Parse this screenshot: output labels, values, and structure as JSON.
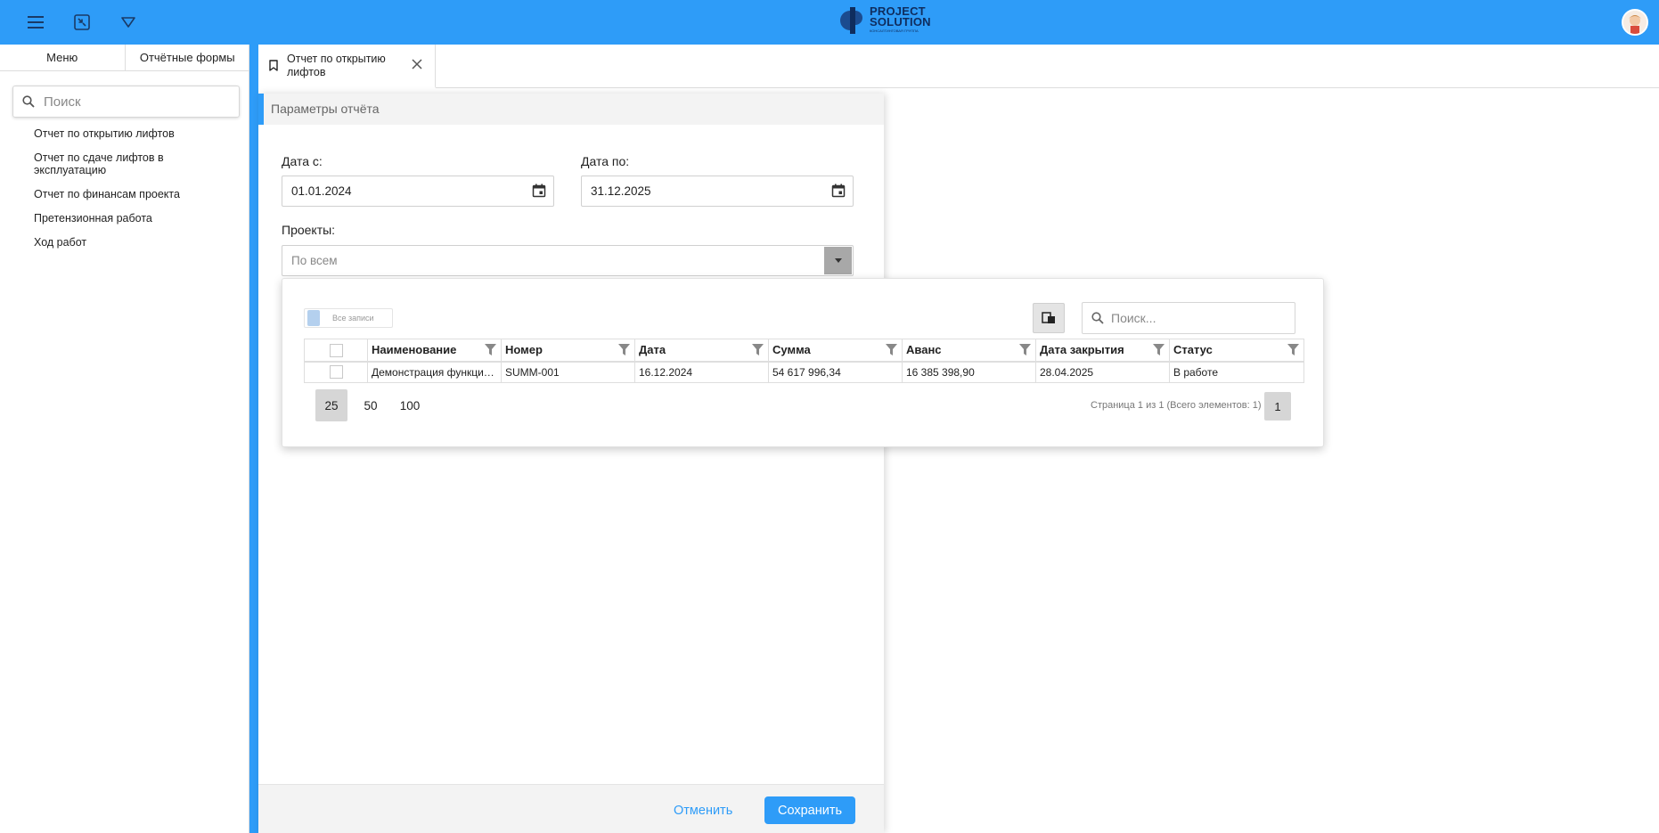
{
  "brand": {
    "line1": "PROJECT",
    "line2": "SOLUTION",
    "tagline": "КОНСАЛТИНГОВАЯ ГРУППА"
  },
  "sidebar": {
    "tabs": [
      {
        "label": "Меню"
      },
      {
        "label": "Отчётные формы"
      }
    ],
    "search_placeholder": "Поиск",
    "items": [
      {
        "label": "Отчет по открытию лифтов"
      },
      {
        "label": "Отчет по сдаче лифтов в эксплуатацию"
      },
      {
        "label": "Отчет по финансам проекта"
      },
      {
        "label": "Претензионная работа"
      },
      {
        "label": "Ход работ"
      }
    ]
  },
  "doc_tab": {
    "label": "Отчет по открытию лифтов"
  },
  "params": {
    "title": "Параметры отчёта",
    "date_from_label": "Дата с:",
    "date_from_value": "01.01.2024",
    "date_to_label": "Дата по:",
    "date_to_value": "31.12.2025",
    "projects_label": "Проекты:",
    "projects_placeholder": "По всем",
    "cancel_label": "Отменить",
    "save_label": "Сохранить"
  },
  "popup": {
    "all_records_label": "Все записи",
    "search_placeholder": "Поиск...",
    "columns": [
      "Наименование",
      "Номер",
      "Дата",
      "Сумма",
      "Аванс",
      "Дата закрытия",
      "Статус"
    ],
    "rows": [
      [
        "Демонстрация функциональных возможностей",
        "SUMM-001",
        "16.12.2024",
        "54 617 996,34",
        "16 385 398,90",
        "28.04.2025",
        "В работе"
      ]
    ],
    "page_sizes": [
      "25",
      "50",
      "100"
    ],
    "page_info": "Страница 1 из 1 (Всего элементов: 1)",
    "current_page": "1"
  },
  "colors": {
    "accent": "#2e9cf8",
    "logo": "#0f2d5e"
  }
}
